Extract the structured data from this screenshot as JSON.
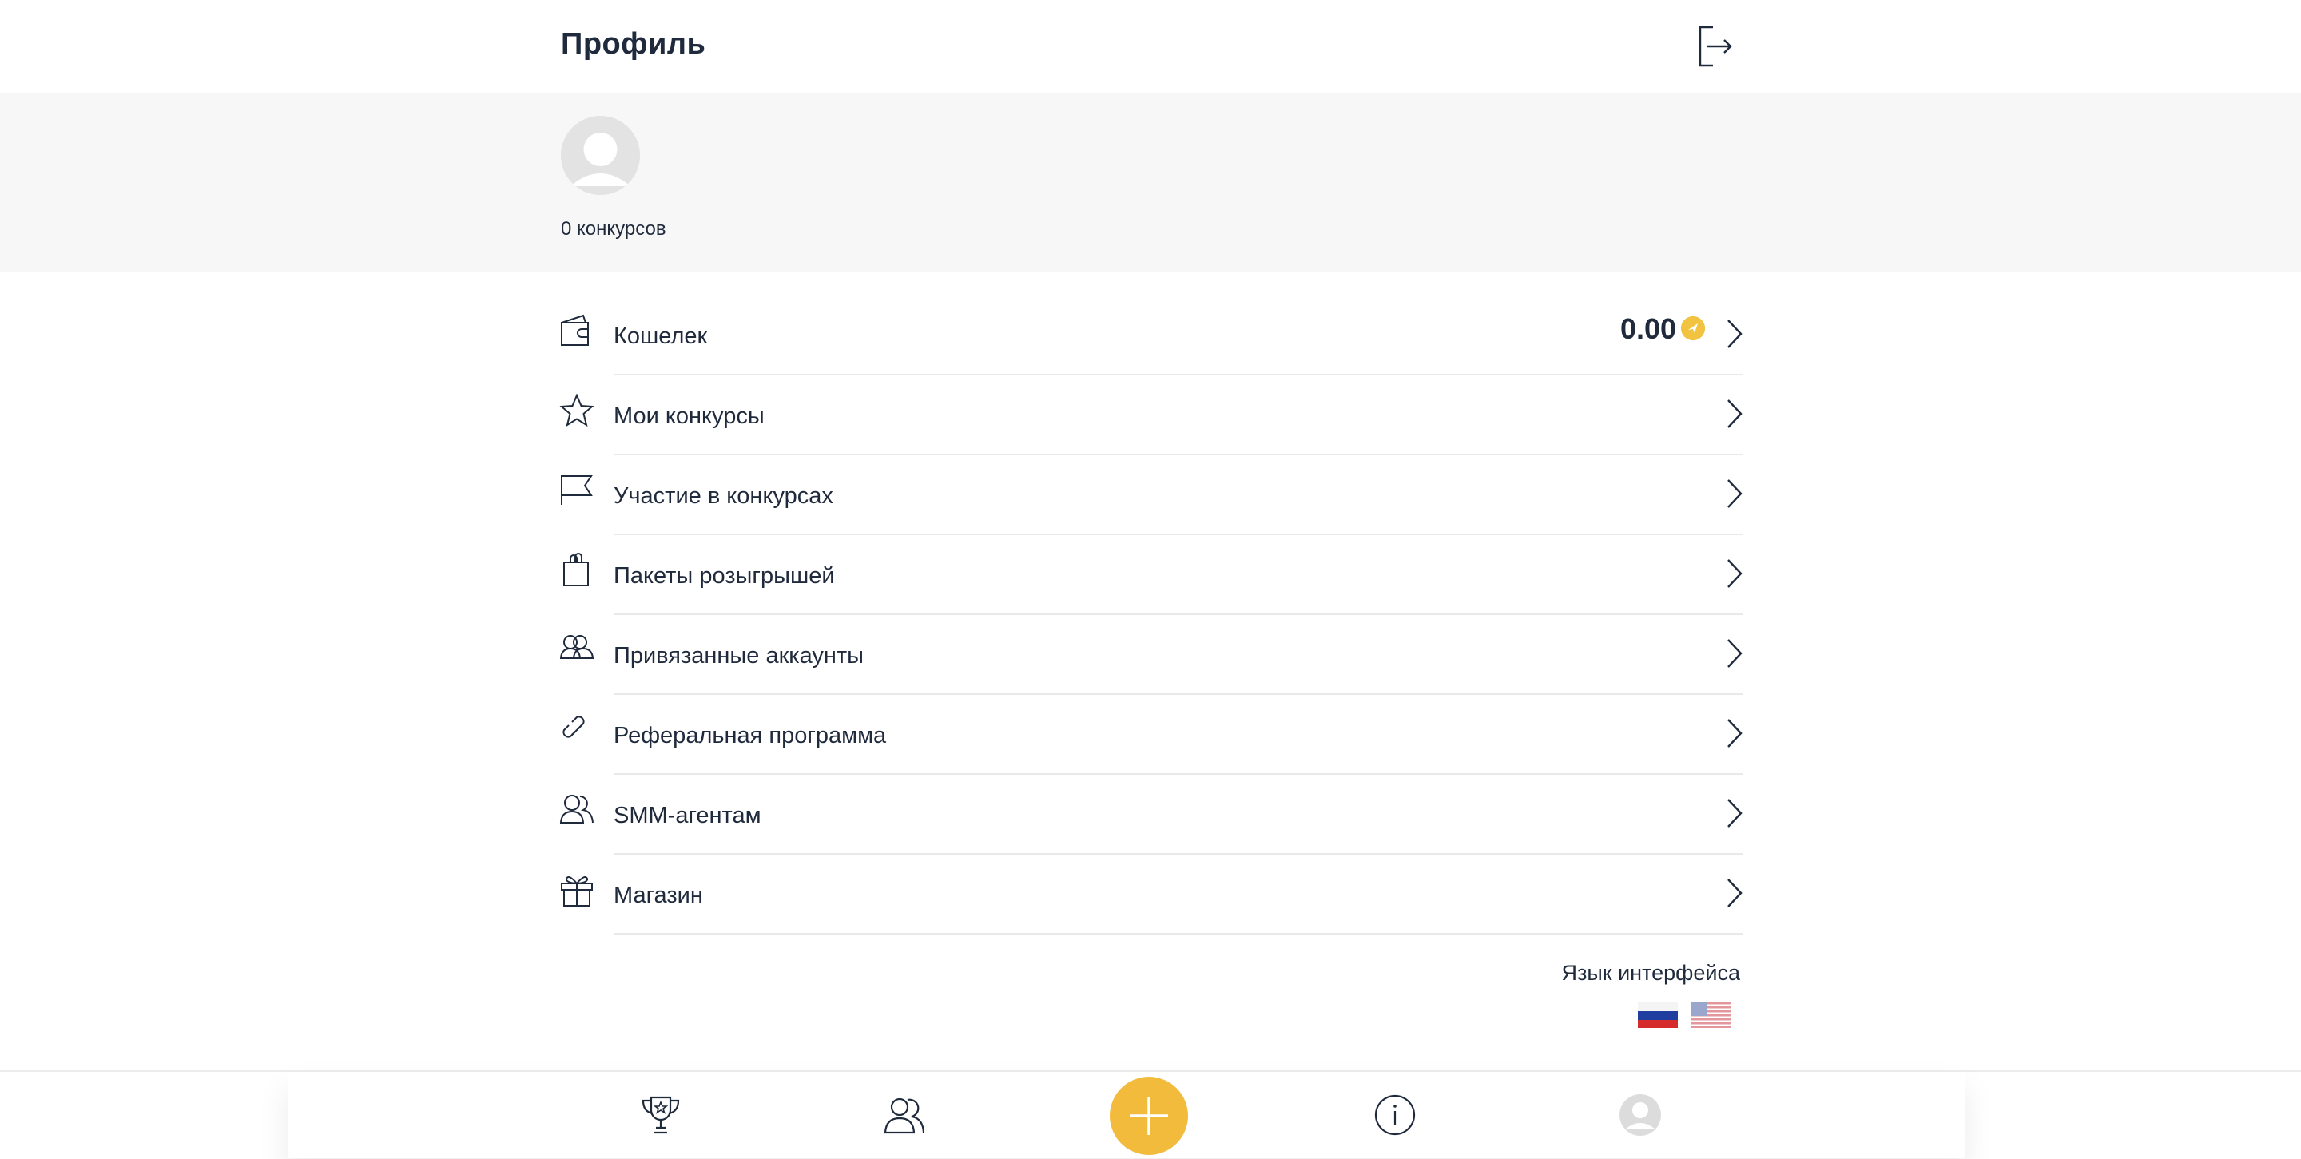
{
  "header": {
    "title": "Профиль",
    "logout_icon": "logout-icon"
  },
  "profile": {
    "contests_count": "0 конкурсов"
  },
  "menu": {
    "items": [
      {
        "label": "Кошелек",
        "icon": "wallet-icon"
      },
      {
        "label": "Мои конкурсы",
        "icon": "star-icon"
      },
      {
        "label": "Участие в конкурсах",
        "icon": "flag-icon"
      },
      {
        "label": "Пакеты розыгрышей",
        "icon": "bag-icon"
      },
      {
        "label": "Привязанные аккаунты",
        "icon": "accounts-icon"
      },
      {
        "label": "Реферальная программа",
        "icon": "link-icon"
      },
      {
        "label": "SMM-агентам",
        "icon": "agents-icon"
      },
      {
        "label": "Магазин",
        "icon": "gift-icon"
      }
    ],
    "wallet_balance": "0.00"
  },
  "language": {
    "title": "Язык интерфейса",
    "options": [
      "ru-flag",
      "us-flag"
    ]
  },
  "tabbar": {
    "items": [
      "trophy-icon",
      "users-icon",
      "plus-icon",
      "info-icon",
      "profile-icon"
    ],
    "accent_color": "#f2bb3c"
  }
}
